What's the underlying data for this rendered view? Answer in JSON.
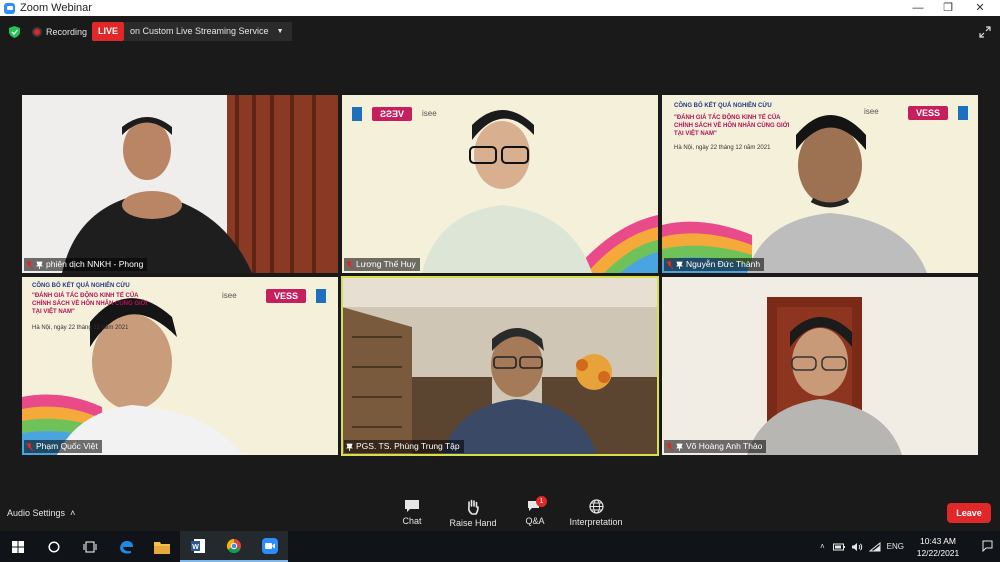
{
  "window": {
    "title": "Zoom Webinar",
    "minimize": "—",
    "restore": "❐",
    "close": "✕"
  },
  "topbar": {
    "recording_label": "Recording",
    "live_label": "LIVE",
    "stream_label": "on Custom Live Streaming Service"
  },
  "slides": {
    "headline": "CÔNG BỐ KẾT QUẢ NGHIÊN CỨU",
    "subtitle_1": "\"ĐÁNH GIÁ TÁC ĐỘNG KINH TẾ CỦA",
    "subtitle_2": "CHÍNH SÁCH VỀ HÔN NHÂN CÙNG GIỚI",
    "subtitle_3": "TẠI VIỆT NAM\"",
    "date": "Hà Nội, ngày 22 tháng 12 năm 2021",
    "brand": "VESS",
    "partner": "isee"
  },
  "participants": [
    {
      "name": "phiên dịch NNKH - Phong"
    },
    {
      "name": "Lương Thế Huy"
    },
    {
      "name": "Nguyễn Đức Thành"
    },
    {
      "name": "Phạm Quốc Việt"
    },
    {
      "name": "PGS. TS. Phùng Trung Tập"
    },
    {
      "name": "Võ Hoàng Anh Thảo"
    }
  ],
  "controls": {
    "audio_settings": "Audio Settings",
    "chat": "Chat",
    "raise_hand": "Raise Hand",
    "qa": "Q&A",
    "qa_badge": "1",
    "interpretation": "Interpretation",
    "leave": "Leave"
  },
  "taskbar": {
    "language": "ENG",
    "time": "10:43 AM",
    "date": "12/22/2021"
  },
  "colors": {
    "accent": "#2d8cff",
    "live_red": "#e02828",
    "active_speaker": "#d6e04a",
    "vess": "#c51f5d"
  }
}
